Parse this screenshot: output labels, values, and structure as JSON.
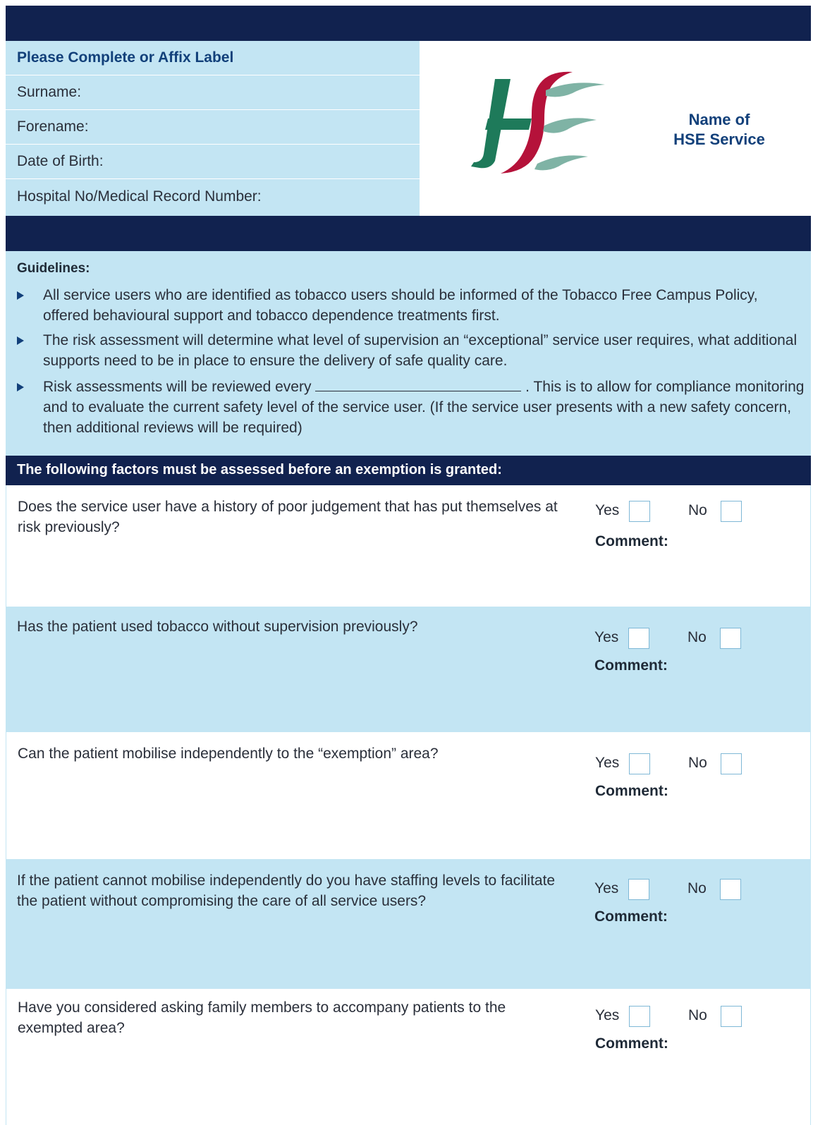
{
  "label_panel": {
    "heading": "Please Complete or Affix Label",
    "fields": [
      "Surname:",
      "Forename:",
      "Date of Birth:",
      "Hospital No/Medical Record Number:"
    ]
  },
  "logo": {
    "icon": "hse-logo",
    "text": "HSE",
    "colors": {
      "green": "#1e7a5a",
      "red": "#b5123a",
      "teal": "#7fb3a5"
    }
  },
  "service": {
    "line1": "Name of",
    "line2": "HSE Service"
  },
  "guidelines": {
    "title": "Guidelines:",
    "bullets": [
      "All service users who are identified as tobacco users should be informed of the Tobacco Free Campus Policy, offered behavioural support and tobacco dependence treatments first.",
      "The risk assessment will determine what level of supervision an “exceptional” service user requires, what additional supports need to be in place to ensure the delivery of safe quality care.",
      "Risk assessments will be reviewed every",
      ". This is to allow for compliance monitoring and to evaluate the current safety level of the service user. (If the service user presents with a new safety concern, then additional reviews will be required)"
    ]
  },
  "factors": {
    "title": "The following factors must be assessed before an exemption is granted:",
    "yes_label": "Yes",
    "no_label": "No",
    "comment_label": "Comment:",
    "questions": [
      "Does the service user have a history of poor judgement that has put themselves at risk previously?",
      "Has the patient used tobacco without supervision previously?",
      "Can the patient mobilise independently to the “exemption” area?",
      "If the patient cannot mobilise independently do you have staffing levels to facilitate the patient without compromising the care of all service users?",
      "Have you considered asking family members to accompany patients to the exempted area?"
    ]
  },
  "colors": {
    "navy": "#11224f",
    "light_blue": "#c3e5f3",
    "heading_blue": "#12407a"
  }
}
